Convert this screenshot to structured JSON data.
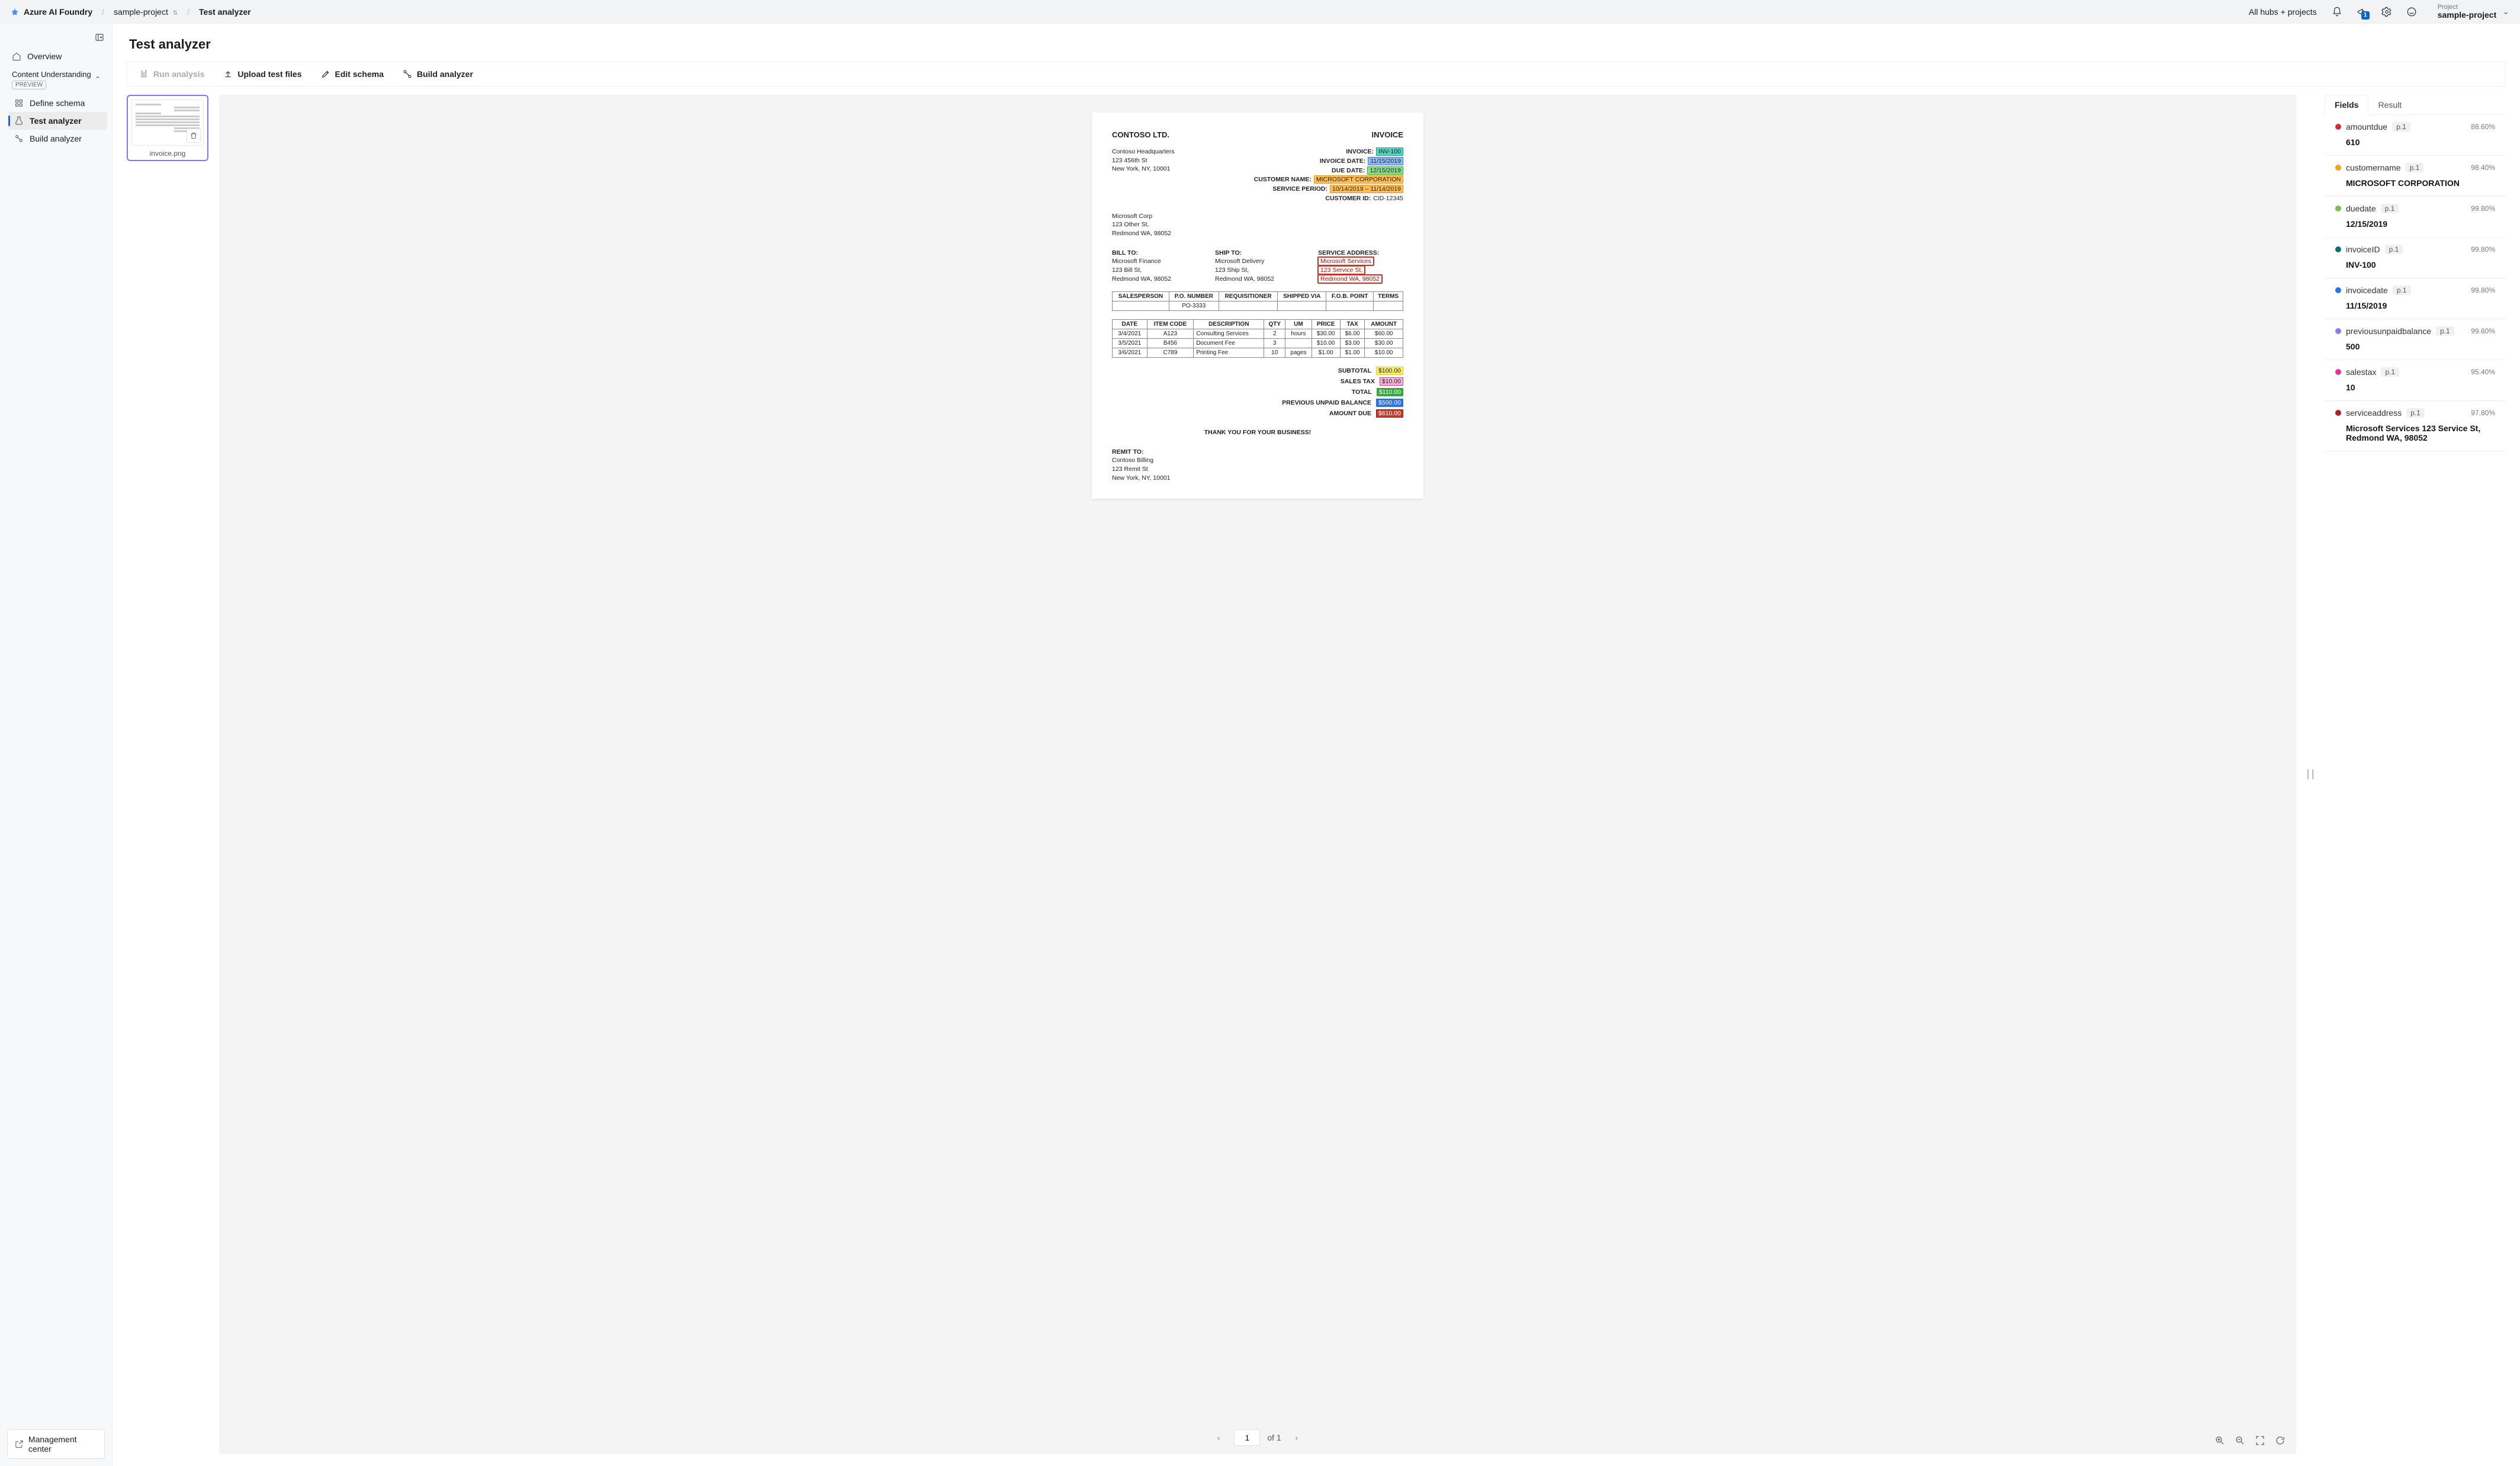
{
  "header": {
    "brand": "Azure AI Foundry",
    "crumb_project": "sample-project",
    "crumb_page": "Test analyzer",
    "all_hubs": "All hubs + projects",
    "announcement_badge": "1",
    "project_label": "Project",
    "project_name": "sample-project"
  },
  "sidebar": {
    "overview": "Overview",
    "group_title": "Content Understanding",
    "preview_chip": "PREVIEW",
    "define_schema": "Define schema",
    "test_analyzer": "Test analyzer",
    "build_analyzer": "Build analyzer",
    "management_center": "Management center"
  },
  "page": {
    "title": "Test analyzer"
  },
  "actions": {
    "run_analysis": "Run analysis",
    "upload": "Upload test files",
    "edit_schema": "Edit schema",
    "build_analyzer": "Build analyzer"
  },
  "thumb": {
    "caption": "invoice.png"
  },
  "invoice": {
    "company": "CONTOSO LTD.",
    "doc_label": "INVOICE",
    "from_lines": [
      "Contoso Headquarters",
      "123 456th St",
      "New York, NY, 10001"
    ],
    "right": {
      "invoice_k": "INVOICE:",
      "invoice_v": "INV-100",
      "invoice_date_k": "INVOICE DATE:",
      "invoice_date_v": "11/15/2019",
      "due_date_k": "DUE DATE:",
      "due_date_v": "12/15/2019",
      "customer_name_k": "CUSTOMER NAME:",
      "customer_name_v": "MICROSOFT CORPORATION",
      "service_period_k": "SERVICE PERIOD:",
      "service_period_v": "10/14/2019 – 11/14/2019",
      "customer_id_k": "CUSTOMER ID:",
      "customer_id_v": "CID-12345"
    },
    "ship_from_lines": [
      "Microsoft Corp",
      "123 Other St,",
      "Redmond WA, 98052"
    ],
    "bill_to": {
      "hd": "BILL TO:",
      "lines": [
        "Microsoft Finance",
        "123 Bill St,",
        "Redmond WA, 98052"
      ]
    },
    "ship_to": {
      "hd": "SHIP TO:",
      "lines": [
        "Microsoft Delivery",
        "123 Ship St,",
        "Redmond WA, 98052"
      ]
    },
    "service_addr": {
      "hd": "SERVICE ADDRESS:",
      "lines": [
        "Microsoft Services",
        "123 Service St,",
        "Redmond WA, 98052"
      ]
    },
    "t1_headers": [
      "SALESPERSON",
      "P.O. NUMBER",
      "REQUISITIONER",
      "SHIPPED VIA",
      "F.O.B. POINT",
      "TERMS"
    ],
    "t1_row": [
      "",
      "PO-3333",
      "",
      "",
      "",
      ""
    ],
    "t2_headers": [
      "DATE",
      "ITEM CODE",
      "DESCRIPTION",
      "QTY",
      "UM",
      "PRICE",
      "TAX",
      "AMOUNT"
    ],
    "t2_rows": [
      [
        "3/4/2021",
        "A123",
        "Consulting Services",
        "2",
        "hours",
        "$30.00",
        "$6.00",
        "$60.00"
      ],
      [
        "3/5/2021",
        "B456",
        "Document Fee",
        "3",
        "",
        "$10.00",
        "$3.00",
        "$30.00"
      ],
      [
        "3/6/2021",
        "C789",
        "Printing Fee",
        "10",
        "pages",
        "$1.00",
        "$1.00",
        "$10.00"
      ]
    ],
    "totals": {
      "subtotal_k": "SUBTOTAL",
      "subtotal_v": "$100.00",
      "salestax_k": "SALES TAX",
      "salestax_v": "$10.00",
      "total_k": "TOTAL",
      "total_v": "$110.00",
      "prev_k": "PREVIOUS UNPAID BALANCE",
      "prev_v": "$500.00",
      "due_k": "AMOUNT DUE",
      "due_v": "$610.00"
    },
    "thanks": "THANK YOU FOR YOUR BUSINESS!",
    "remit": {
      "hd": "REMIT TO:",
      "lines": [
        "Contoso Billing",
        "123 Remit St",
        "New York, NY, 10001"
      ]
    }
  },
  "pager": {
    "page": "1",
    "of_text": "of 1"
  },
  "results": {
    "tabs": {
      "fields": "Fields",
      "result": "Result"
    },
    "page_tag": "p.1",
    "items": [
      {
        "color": "#d32f2f",
        "name": "amountdue",
        "conf": "88.60%",
        "value": "610"
      },
      {
        "color": "#f6a21c",
        "name": "customername",
        "conf": "98.40%",
        "value": "MICROSOFT CORPORATION"
      },
      {
        "color": "#7ac043",
        "name": "duedate",
        "conf": "99.80%",
        "value": "12/15/2019"
      },
      {
        "color": "#0f6e70",
        "name": "invoiceID",
        "conf": "99.80%",
        "value": "INV-100"
      },
      {
        "color": "#1f7ae6",
        "name": "invoicedate",
        "conf": "99.80%",
        "value": "11/15/2019"
      },
      {
        "color": "#8d7bf0",
        "name": "previousunpaidbalance",
        "conf": "99.60%",
        "value": "500"
      },
      {
        "color": "#e62ea0",
        "name": "salestax",
        "conf": "95.40%",
        "value": "10"
      },
      {
        "color": "#b51d1d",
        "name": "serviceaddress",
        "conf": "97.80%",
        "value": "Microsoft Services 123 Service St, Redmond WA, 98052"
      }
    ]
  }
}
